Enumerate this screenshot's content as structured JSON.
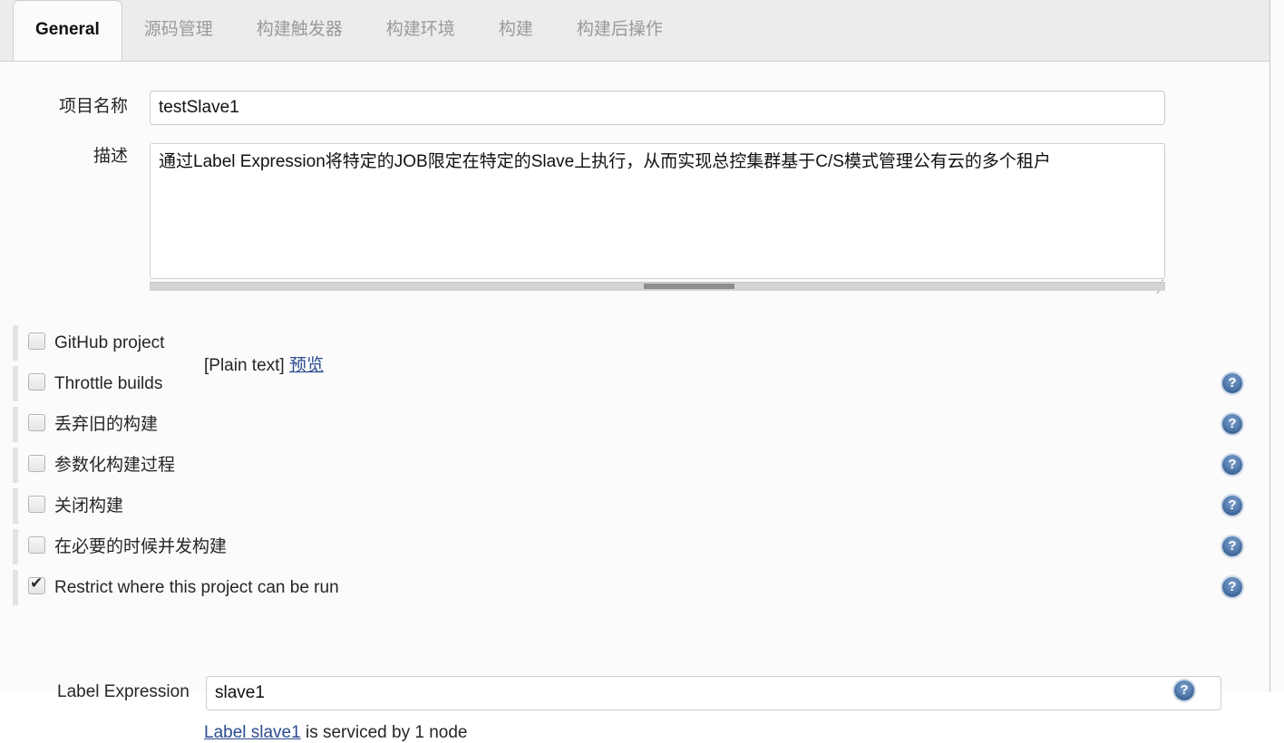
{
  "tabs": [
    {
      "label": "General",
      "active": true
    },
    {
      "label": "源码管理",
      "active": false
    },
    {
      "label": "构建触发器",
      "active": false
    },
    {
      "label": "构建环境",
      "active": false
    },
    {
      "label": "构建",
      "active": false
    },
    {
      "label": "构建后操作",
      "active": false
    }
  ],
  "form": {
    "project_name": {
      "label": "项目名称",
      "value": "testSlave1",
      "placeholder": ""
    },
    "description": {
      "label": "描述",
      "value": "通过Label Expression将特定的JOB限定在特定的Slave上执行，从而实现总控集群基于C/S模式管理公有云的多个租户",
      "placeholder": "",
      "format_note": "[Plain text]",
      "preview_link": "预览"
    },
    "label_expression": {
      "label": "Label Expression",
      "value": "slave1",
      "placeholder": "",
      "note_link": "Label slave1",
      "note_rest": " is serviced by 1 node"
    }
  },
  "options": [
    {
      "label": "GitHub project",
      "checked": false,
      "help": true,
      "help_visible": false
    },
    {
      "label": "Throttle builds",
      "checked": false,
      "help": true,
      "help_visible": true
    },
    {
      "label": "丢弃旧的构建",
      "checked": false,
      "help": true,
      "help_visible": true
    },
    {
      "label": "参数化构建过程",
      "checked": false,
      "help": true,
      "help_visible": true
    },
    {
      "label": "关闭构建",
      "checked": false,
      "help": true,
      "help_visible": true
    },
    {
      "label": "在必要的时候并发构建",
      "checked": false,
      "help": true,
      "help_visible": true
    },
    {
      "label": "Restrict where this project can be run",
      "checked": true,
      "help": true,
      "help_visible": true
    }
  ],
  "icons": {
    "help": "help-question-icon",
    "resize": "resize-grip-icon",
    "checkmark": "check-icon"
  },
  "colors": {
    "tabbar_bg": "#ececec",
    "content_bg": "#fbfbfb",
    "link": "#2b4b8f",
    "help_icon": "#3f6699",
    "text": "#262626",
    "border": "#cdcdcd"
  }
}
